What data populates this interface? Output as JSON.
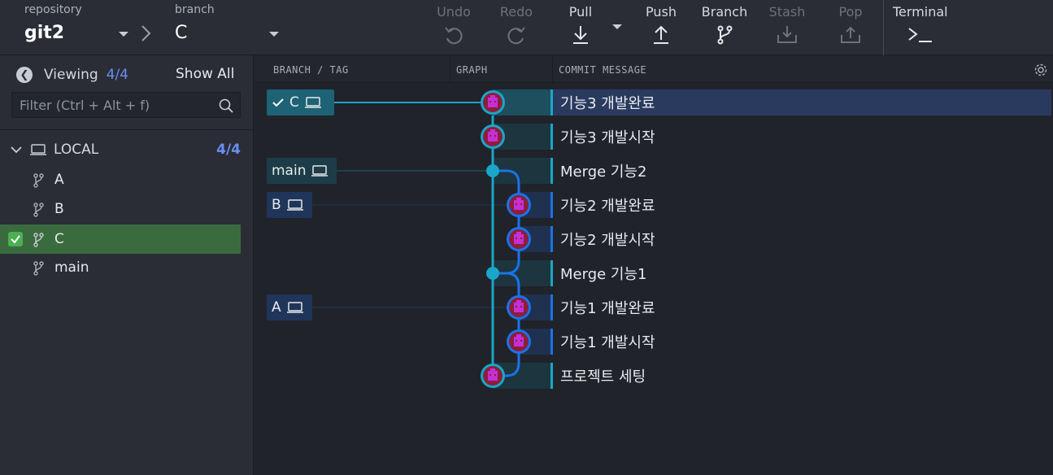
{
  "toolbar": {
    "repository_label": "repository",
    "repository_value": "git2",
    "branch_label": "branch",
    "branch_value": "C",
    "undo": "Undo",
    "redo": "Redo",
    "pull": "Pull",
    "push": "Push",
    "branch": "Branch",
    "stash": "Stash",
    "pop": "Pop",
    "terminal": "Terminal"
  },
  "sidebar": {
    "viewing_label": "Viewing",
    "viewing_count": "4/4",
    "show_all": "Show All",
    "filter_placeholder": "Filter (Ctrl + Alt + f)",
    "local_label": "LOCAL",
    "local_count": "4/4",
    "branches": [
      {
        "name": "A",
        "active": false
      },
      {
        "name": "B",
        "active": false
      },
      {
        "name": "C",
        "active": true
      },
      {
        "name": "main",
        "active": false
      }
    ]
  },
  "columns": {
    "branch_tag": "BRANCH / TAG",
    "graph": "GRAPH",
    "commit_message": "COMMIT MESSAGE"
  },
  "tags": {
    "c": "C",
    "main": "main",
    "b": "B",
    "a": "A"
  },
  "commits": [
    {
      "message": "기능3 개발완료"
    },
    {
      "message": "기능3 개발시작"
    },
    {
      "message": "Merge 기능2"
    },
    {
      "message": "기능2 개발완료"
    },
    {
      "message": "기능2 개발시작"
    },
    {
      "message": "Merge 기능1"
    },
    {
      "message": "기능1 개발완료"
    },
    {
      "message": "기능1 개발시작"
    },
    {
      "message": "프로젝트 세팅"
    }
  ],
  "colors": {
    "accent_blue": "#6b8ff0",
    "graph_teal": "#1aa6c8",
    "graph_blue": "#1a73e8",
    "active_branch": "#3a6b3f"
  }
}
